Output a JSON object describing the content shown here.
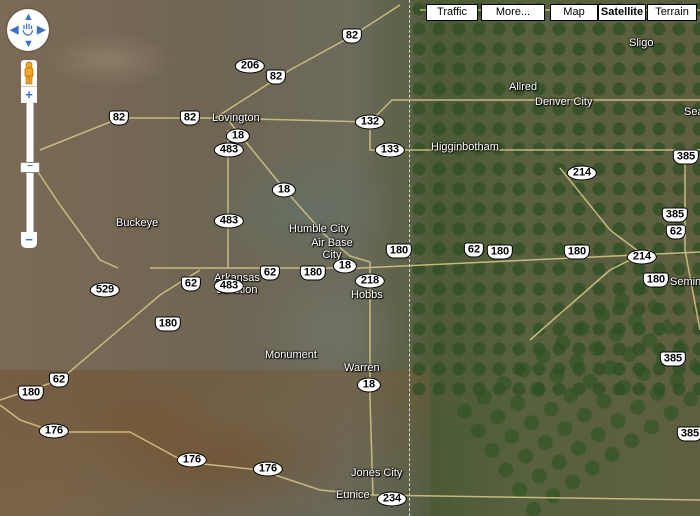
{
  "map_type_buttons": [
    {
      "label": "Traffic",
      "selected": false
    },
    {
      "label": "More...",
      "selected": false
    },
    {
      "label": "Map",
      "selected": false
    },
    {
      "label": "Satellite",
      "selected": true
    },
    {
      "label": "Terrain",
      "selected": false
    }
  ],
  "controls": {
    "pan": {
      "up": "▲",
      "down": "▼",
      "left": "◀",
      "right": "▶",
      "center_icon": "hand-icon"
    },
    "pegman_icon": "pegman-icon",
    "zoom_in": "+",
    "zoom_out": "−",
    "slider_thumb": "−",
    "zoom_level_fraction": 0.5
  },
  "places": [
    {
      "name": "Lovington"
    },
    {
      "name": "Sligo"
    },
    {
      "name": "Allred"
    },
    {
      "name": "Denver City"
    },
    {
      "name": "Higginbotham"
    },
    {
      "name": "Seag"
    },
    {
      "name": "Buckeye"
    },
    {
      "name": "Humble City"
    },
    {
      "name": "Air Base City"
    },
    {
      "name": "Hobbs"
    },
    {
      "name": "Arkansas Junction"
    },
    {
      "name": "Monument"
    },
    {
      "name": "Warren"
    },
    {
      "name": "Jones City"
    },
    {
      "name": "Eunice"
    },
    {
      "name": "Semino"
    }
  ],
  "route_markers": {
    "us_shields": [
      "82",
      "82",
      "82",
      "82",
      "62",
      "180",
      "62",
      "62",
      "180",
      "62",
      "180",
      "180",
      "180",
      "385",
      "385",
      "62",
      "180",
      "385",
      "385",
      "180"
    ],
    "state_ovals": [
      "206",
      "132",
      "18",
      "483",
      "133",
      "18",
      "483",
      "18",
      "218",
      "483",
      "529",
      "214",
      "214",
      "18",
      "176",
      "176",
      "176",
      "234"
    ]
  }
}
